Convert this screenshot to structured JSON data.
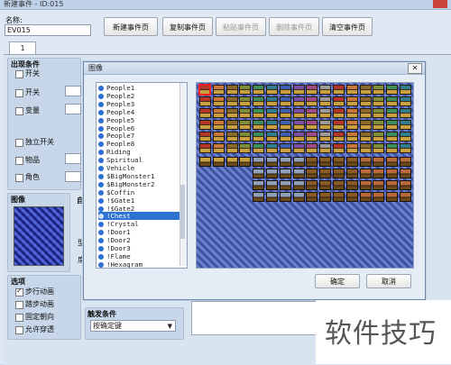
{
  "window": {
    "title": "新建事件 - ID:015"
  },
  "event": {
    "name_label": "名称:",
    "name_value": "EV015"
  },
  "toolbar": {
    "new_page": "新建事件页",
    "copy_page": "复制事件页",
    "paste_page": "粘贴事件页",
    "delete_page": "删除事件页",
    "clear_page": "清空事件页"
  },
  "tab": {
    "page_1": "1"
  },
  "conditions": {
    "title": "出现条件",
    "items": [
      "开关",
      "开关",
      "变量",
      "独立开关",
      "物品",
      "角色"
    ]
  },
  "image_section": {
    "title": "图像"
  },
  "options": {
    "title": "选项",
    "items": [
      {
        "label": "步行动画",
        "checked": true
      },
      {
        "label": "踏步动画",
        "checked": false
      },
      {
        "label": "固定朝向",
        "checked": false
      },
      {
        "label": "允许穿透",
        "checked": false
      }
    ]
  },
  "trigger": {
    "title": "触发条件",
    "value": "按确定键"
  },
  "partial_labels": {
    "auto": "自",
    "stub1": "型",
    "stub2": "度"
  },
  "dialog": {
    "title": "图像",
    "ok": "确定",
    "cancel": "取消",
    "list": [
      "People1",
      "People2",
      "People3",
      "People4",
      "People5",
      "People6",
      "People7",
      "People8",
      "Riding",
      "Spiritual",
      "Vehicle",
      "$BigMonster1",
      "$BigMonster2",
      "$Coffin",
      "!$Gate1",
      "!$Gate2",
      "!Chest",
      "!Crystal",
      "!Door1",
      "!Door2",
      "!Door3",
      "!Flame",
      "!Hexagram"
    ],
    "selected": "!Chest"
  },
  "watermark": {
    "text": "软件技巧"
  },
  "colors": {
    "selection": "#2e73d1",
    "tile_select": "#ff2020",
    "accent": "#c9453a"
  }
}
